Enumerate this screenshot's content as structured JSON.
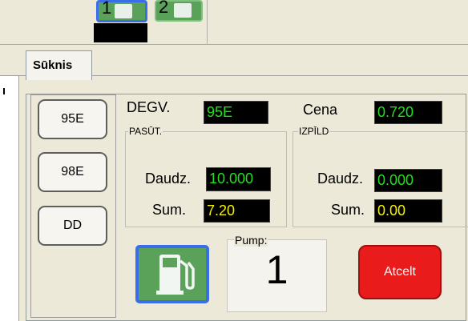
{
  "pump_selector": {
    "thumbs": [
      {
        "number": "1",
        "selected": true
      },
      {
        "number": "2",
        "selected": false
      }
    ]
  },
  "tab": {
    "label": "Sūknis"
  },
  "fuel_buttons": [
    "95E",
    "98E",
    "DD"
  ],
  "fuel": {
    "label": "DEGV.",
    "value": "95E",
    "price_label": "Cena",
    "price_value": "0.720"
  },
  "order_group": {
    "title": "PASŪT.",
    "qty_label": "Daudz.",
    "qty_value": "10.000",
    "sum_label": "Sum.",
    "sum_value": "7.20"
  },
  "done_group": {
    "title": "IZPĪLD",
    "qty_label": "Daudz.",
    "qty_value": "0.000",
    "sum_label": "Sum.",
    "sum_value": "0.00"
  },
  "pump": {
    "label": "Pump:",
    "number": "1"
  },
  "cancel_button": {
    "label": "Atcelt"
  },
  "icons": {
    "fuel_pump": "fuel-pump-icon"
  },
  "colors": {
    "lcd_green": "#22e01c",
    "lcd_yellow": "#f5f000",
    "cancel_red": "#e91b1b",
    "pump_button_green": "#5aa25a",
    "selection_blue": "#3a6ee8"
  }
}
